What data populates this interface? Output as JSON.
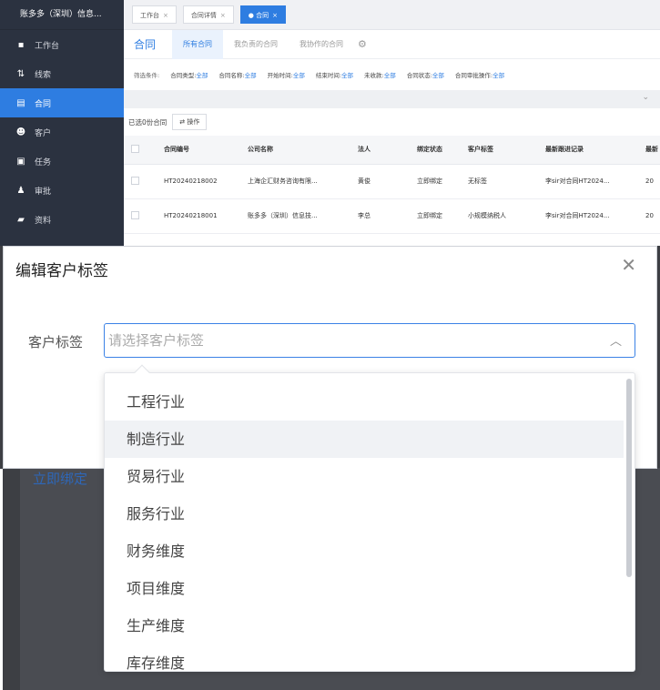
{
  "sidebar": {
    "brand": "账多多（深圳）信息...",
    "items": [
      {
        "label": "工作台",
        "icon": "dashboard-icon",
        "glyph": "▪"
      },
      {
        "label": "线索",
        "icon": "clue-icon",
        "glyph": "⇅"
      },
      {
        "label": "合同",
        "icon": "contract-icon",
        "glyph": "▤"
      },
      {
        "label": "客户",
        "icon": "customers-icon",
        "glyph": "☻"
      },
      {
        "label": "任务",
        "icon": "task-icon",
        "glyph": "▣"
      },
      {
        "label": "审批",
        "icon": "approval-icon",
        "glyph": "♟"
      },
      {
        "label": "资料",
        "icon": "materials-icon",
        "glyph": "▰"
      }
    ]
  },
  "tabs": {
    "t1": "工作台",
    "t2": "合同详情",
    "t3": "合同"
  },
  "subtabs": {
    "title": "合同",
    "all": "所有合同",
    "mine": "我负责的合同",
    "collab": "我协作的合同"
  },
  "filters": {
    "label": "筛选条件:",
    "items": [
      {
        "name": "合同类型:",
        "value": "全部"
      },
      {
        "name": "合同名称:",
        "value": "全部"
      },
      {
        "name": "开始时间:",
        "value": "全部"
      },
      {
        "name": "结束时间:",
        "value": "全部"
      },
      {
        "name": "未收款:",
        "value": "全部"
      },
      {
        "name": "合同状态:",
        "value": "全部"
      },
      {
        "name": "合同审批操作:",
        "value": "全部"
      }
    ]
  },
  "toolbar": {
    "selected": "已选0份合同",
    "op": "操作"
  },
  "table": {
    "headers": [
      "合同编号",
      "公司名称",
      "法人",
      "绑定状态",
      "客户标签",
      "最新跟进记录",
      "最新"
    ],
    "rows": [
      [
        "HT20240218002",
        "上海企汇财务咨询有限...",
        "黄俊",
        "立即绑定",
        "无标签",
        "李sir对合同HT2024...",
        "20"
      ],
      [
        "HT20240218001",
        "账多多（深圳）信息技...",
        "李总",
        "立即绑定",
        "小规模纳税人",
        "李sir对合同HT2024...",
        "20"
      ]
    ]
  },
  "background": {
    "link": "立即绑定"
  },
  "dialog": {
    "title": "编辑客户标签",
    "field_label": "客户标签",
    "placeholder": "请选择客户标签"
  },
  "dropdown": {
    "options": [
      "工程行业",
      "制造行业",
      "贸易行业",
      "服务行业",
      "财务维度",
      "项目维度",
      "生产维度",
      "库存维度"
    ],
    "hovered_index": 1
  }
}
